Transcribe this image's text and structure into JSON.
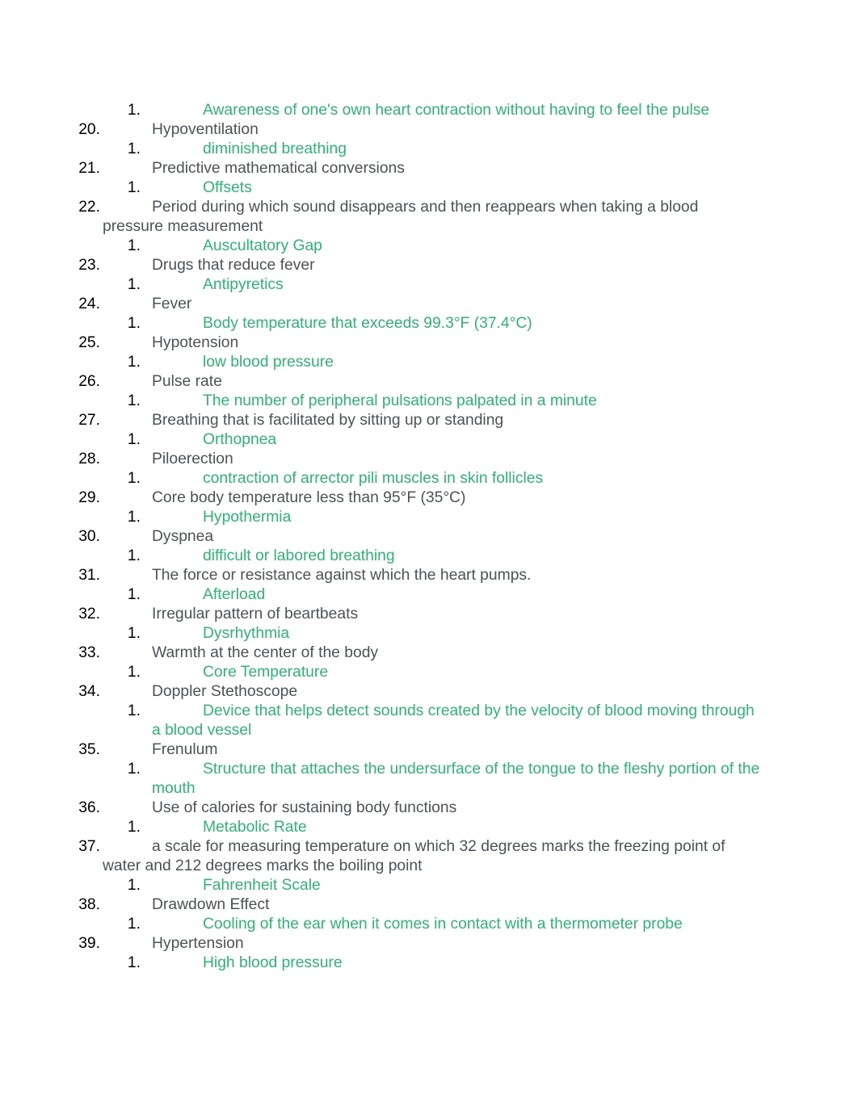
{
  "document": {
    "leading_answer": {
      "marker": "1.",
      "text": "Awareness of one's own heart contraction without having to feel the pulse"
    },
    "items": [
      {
        "number": "20.",
        "question": "Hypoventilation",
        "answer_marker": "1.",
        "answer": "diminished breathing"
      },
      {
        "number": "21.",
        "question": "Predictive mathematical conversions",
        "answer_marker": "1.",
        "answer": "Offsets"
      },
      {
        "number": "22.",
        "question": "Period during which sound disappears and then reappears when taking a blood pressure measurement",
        "answer_marker": "1.",
        "answer": "Auscultatory Gap"
      },
      {
        "number": "23.",
        "question": "Drugs that reduce fever",
        "answer_marker": "1.",
        "answer": "Antipyretics"
      },
      {
        "number": "24.",
        "question": "Fever",
        "answer_marker": "1.",
        "answer": "Body temperature that exceeds 99.3°F (37.4°C)"
      },
      {
        "number": "25.",
        "question": "Hypotension",
        "answer_marker": "1.",
        "answer": "low blood pressure"
      },
      {
        "number": "26.",
        "question": "Pulse rate",
        "answer_marker": "1.",
        "answer": "The number of peripheral pulsations palpated in a minute"
      },
      {
        "number": "27.",
        "question": "Breathing that is facilitated by sitting up or standing",
        "answer_marker": "1.",
        "answer": "Orthopnea"
      },
      {
        "number": "28.",
        "question": "Piloerection",
        "answer_marker": "1.",
        "answer": "contraction of arrector pili muscles in skin follicles"
      },
      {
        "number": "29.",
        "question": "Core body temperature less than 95°F (35°C)",
        "answer_marker": "1.",
        "answer": "Hypothermia"
      },
      {
        "number": "30.",
        "question": "Dyspnea",
        "answer_marker": "1.",
        "answer": "difficult or labored breathing"
      },
      {
        "number": "31.",
        "question": "The force or resistance against which the heart pumps.",
        "answer_marker": "1.",
        "answer": "Afterload"
      },
      {
        "number": "32.",
        "question": "Irregular pattern of beartbeats",
        "answer_marker": "1.",
        "answer": "Dysrhythmia"
      },
      {
        "number": "33.",
        "question": "Warmth at the center of the body",
        "answer_marker": "1.",
        "answer": "Core Temperature"
      },
      {
        "number": "34.",
        "question": "Doppler Stethoscope",
        "answer_marker": "1.",
        "answer": "Device that helps detect sounds created by the velocity of blood moving through a blood vessel"
      },
      {
        "number": "35.",
        "question": "Frenulum",
        "answer_marker": "1.",
        "answer": "Structure that attaches the undersurface of the tongue to the fleshy portion of the mouth"
      },
      {
        "number": "36.",
        "question": "Use of calories for sustaining body functions",
        "answer_marker": "1.",
        "answer": "Metabolic Rate"
      },
      {
        "number": "37.",
        "question": "a scale for measuring temperature on which 32 degrees marks the freezing point of water and 212 degrees marks the boiling point",
        "answer_marker": "1.",
        "answer": "Fahrenheit Scale"
      },
      {
        "number": "38.",
        "question": "Drawdown Effect",
        "answer_marker": "1.",
        "answer": "Cooling of the ear when it comes in contact with a thermometer probe"
      },
      {
        "number": "39.",
        "question": "Hypertension",
        "answer_marker": "1.",
        "answer": "High blood pressure"
      }
    ]
  },
  "colors": {
    "number": "#000000",
    "question": "#4a5358",
    "answer": "#2bb673"
  }
}
